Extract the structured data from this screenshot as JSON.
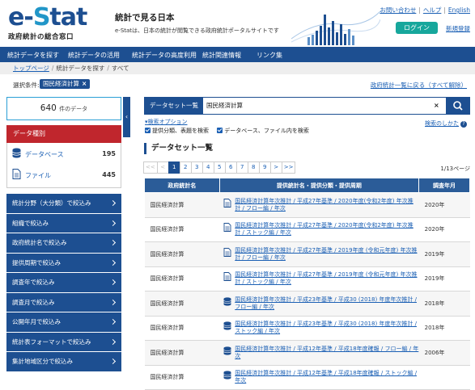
{
  "header": {
    "logo_main": "e-Stat",
    "logo_sub": "政府統計の総合窓口",
    "site_title": "統計で見る日本",
    "site_sub": "e-Statは、日本の統計が閲覧できる政府統計ポータルサイトです",
    "links": [
      "お問い合わせ",
      "ヘルプ",
      "English"
    ],
    "login_label": "ログイン",
    "signup_label": "新規登録"
  },
  "nav": [
    "統計データを探す",
    "統計データの活用",
    "統計データの高度利用",
    "統計関連情報",
    "リンク集"
  ],
  "breadcrumb": [
    "トップページ",
    "統計データを探す",
    "すべて"
  ],
  "condition": {
    "label": "選択条件:",
    "chip": "国民経済計算",
    "right_link": "政府統計一覧に戻る（すべて解除）"
  },
  "sidebar": {
    "count_value": "640",
    "count_unit": "件のデータ",
    "dtype_heading": "データ種別",
    "dtypes": [
      {
        "label": "データベース",
        "count": "195",
        "icon": "database-icon"
      },
      {
        "label": "ファイル",
        "count": "445",
        "icon": "file-icon"
      }
    ],
    "filters": [
      "統計分野（大分類）で絞込み",
      "組織で絞込み",
      "政府統計名で絞込み",
      "提供周期で絞込み",
      "調査年で絞込み",
      "調査月で絞込み",
      "公開年月で絞込み",
      "統計表フォーマットで絞込み",
      "集計地域区分で絞込み"
    ]
  },
  "search": {
    "select_label": "データセット一覧",
    "query": "国民経済計算",
    "clear": "×",
    "options_link": "検索オプション",
    "howto": "検索のしかた",
    "check1": "提供分類、表題を検索",
    "check2": "データベース、ファイル内を検索"
  },
  "results": {
    "title": "データセット一覧",
    "pager": [
      "<<",
      "<",
      "1",
      "2",
      "3",
      "4",
      "5",
      "6",
      "7",
      "8",
      "9",
      ">",
      ">>"
    ],
    "page_of": "1/13ページ",
    "columns": [
      "政府統計名",
      "提供統計名・提供分類・提供周期",
      "調査年月"
    ],
    "rows": [
      {
        "stat": "国民経済計算",
        "title": "国民経済計算年次推計 / 平成27年基準 / 2020年度(令和2年度) 年次推計 / フロー編 / 年次",
        "year": "2020年",
        "icon": "file-icon"
      },
      {
        "stat": "国民経済計算",
        "title": "国民経済計算年次推計 / 平成27年基準 / 2020年度(令和2年度) 年次推計 / ストック編 / 年次",
        "year": "2020年",
        "icon": "file-icon"
      },
      {
        "stat": "国民経済計算",
        "title": "国民経済計算年次推計 / 平成27年基準 / 2019年度 (令和元年度) 年次推計 / フロー編 / 年次",
        "year": "2019年",
        "icon": "file-icon"
      },
      {
        "stat": "国民経済計算",
        "title": "国民経済計算年次推計 / 平成27年基準 / 2019年度 (令和元年度) 年次推計 / ストック編 / 年次",
        "year": "2019年",
        "icon": "file-icon"
      },
      {
        "stat": "国民経済計算",
        "title": "国民経済計算年次推計 / 平成23年基準 / 平成30 (2018) 年度年次推計 / フロー編 / 年次",
        "year": "2018年",
        "icon": "database-icon"
      },
      {
        "stat": "国民経済計算",
        "title": "国民経済計算年次推計 / 平成23年基準 / 平成30 (2018) 年度年次推計 / ストック編 / 年次",
        "year": "2018年",
        "icon": "database-icon"
      },
      {
        "stat": "国民経済計算",
        "title": "国民経済計算年次推計 / 平成12年基準 / 平成18年度確報 / フロー編 / 年次",
        "year": "2006年",
        "icon": "database-icon"
      },
      {
        "stat": "国民経済計算",
        "title": "国民経済計算年次推計 / 平成12年基準 / 平成18年度確報 / ストック編 / 年次",
        "year": "",
        "icon": "database-icon"
      }
    ]
  },
  "colors": {
    "brand": "#1d4f91",
    "accent": "#2196c8",
    "red": "#c0262d",
    "teal": "#17a79c"
  }
}
